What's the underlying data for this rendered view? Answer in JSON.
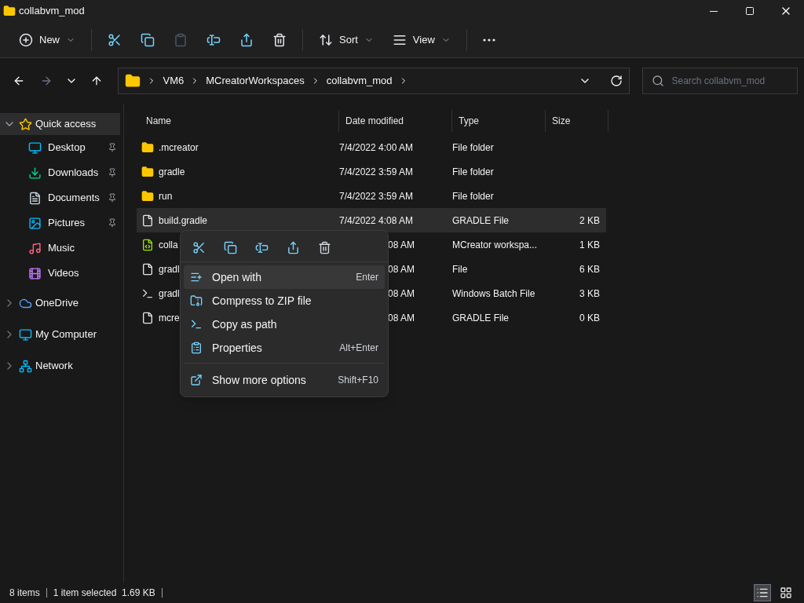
{
  "window": {
    "title": "collabvm_mod"
  },
  "toolbar": {
    "items": [
      {
        "kind": "new",
        "label": "New",
        "disabled": false
      },
      {
        "kind": "cut",
        "disabled": false
      },
      {
        "kind": "copy",
        "disabled": false
      },
      {
        "kind": "paste",
        "disabled": true
      },
      {
        "kind": "rename",
        "disabled": false
      },
      {
        "kind": "share",
        "disabled": false
      },
      {
        "kind": "delete",
        "disabled": false
      },
      {
        "kind": "sort",
        "label": "Sort",
        "disabled": false
      },
      {
        "kind": "view",
        "label": "View",
        "disabled": false
      },
      {
        "kind": "more",
        "disabled": false
      }
    ]
  },
  "address": {
    "path": [
      "VM6",
      "MCreatorWorkspaces",
      "collabvm_mod"
    ],
    "search_placeholder": "Search collabvm_mod"
  },
  "sidebar": {
    "items": [
      {
        "kind": "star",
        "label": "Quick access",
        "expanded": true,
        "selected": true,
        "children": [
          {
            "kind": "desktop",
            "label": "Desktop",
            "pinned": true,
            "selected": false
          },
          {
            "kind": "downloads",
            "label": "Downloads",
            "pinned": true,
            "selected": false
          },
          {
            "kind": "documents",
            "label": "Documents",
            "pinned": true,
            "selected": false
          },
          {
            "kind": "pictures",
            "label": "Pictures",
            "pinned": true,
            "selected": false
          },
          {
            "kind": "music",
            "label": "Music",
            "pinned": false,
            "selected": false
          },
          {
            "kind": "videos",
            "label": "Videos",
            "pinned": false,
            "selected": false
          }
        ]
      },
      {
        "kind": "cloud",
        "label": "OneDrive",
        "expanded": false,
        "selected": false
      },
      {
        "kind": "computer",
        "label": "My Computer",
        "expanded": false,
        "selected": false
      },
      {
        "kind": "network",
        "label": "Network",
        "expanded": false,
        "selected": false
      }
    ]
  },
  "table": {
    "columns": [
      "Name",
      "Date modified",
      "Type",
      "Size"
    ],
    "rows": [
      {
        "kind": "folder",
        "name": ".mcreator",
        "date": "7/4/2022 4:00 AM",
        "type": "File folder",
        "selected": false,
        "covered": false
      },
      {
        "kind": "folder",
        "name": "gradle",
        "date": "7/4/2022 3:59 AM",
        "type": "File folder",
        "selected": false,
        "covered": false
      },
      {
        "kind": "folder",
        "name": "run",
        "date": "7/4/2022 3:59 AM",
        "type": "File folder",
        "selected": false,
        "covered": false
      },
      {
        "kind": "file",
        "name": "build.gradle",
        "date": "7/4/2022 4:08 AM",
        "type": "GRADLE File",
        "size": "2 KB",
        "selected": true,
        "covered": false
      },
      {
        "kind": "mcreator",
        "name": "colla",
        "date": "08 AM",
        "type": "MCreator workspa...",
        "size": "1 KB",
        "selected": false,
        "covered": true
      },
      {
        "kind": "file",
        "name": "gradl",
        "date": "08 AM",
        "type": "File",
        "size": "6 KB",
        "selected": false,
        "covered": true
      },
      {
        "kind": "batch",
        "name": "gradl",
        "date": "08 AM",
        "type": "Windows Batch File",
        "size": "3 KB",
        "selected": false,
        "covered": true
      },
      {
        "kind": "file",
        "name": "mcre",
        "date": "08 AM",
        "type": "GRADLE File",
        "size": "0 KB",
        "selected": false,
        "covered": true
      }
    ]
  },
  "context_menu": {
    "items": [
      {
        "kind": "open",
        "label": "Open with",
        "shortcut": "Enter",
        "highlighted": true,
        "separated": false
      },
      {
        "kind": "zip",
        "label": "Compress to ZIP file",
        "highlighted": false,
        "separated": false
      },
      {
        "kind": "path",
        "label": "Copy as path",
        "highlighted": false,
        "separated": false
      },
      {
        "kind": "props",
        "label": "Properties",
        "shortcut": "Alt+Enter",
        "highlighted": false,
        "separated": false
      },
      {
        "kind": "more",
        "label": "Show more options",
        "shortcut": "Shift+F10",
        "highlighted": false,
        "separated": true
      }
    ]
  },
  "status_bar": {
    "count": "8 items",
    "selection": "1 item selected  1.69 KB"
  }
}
